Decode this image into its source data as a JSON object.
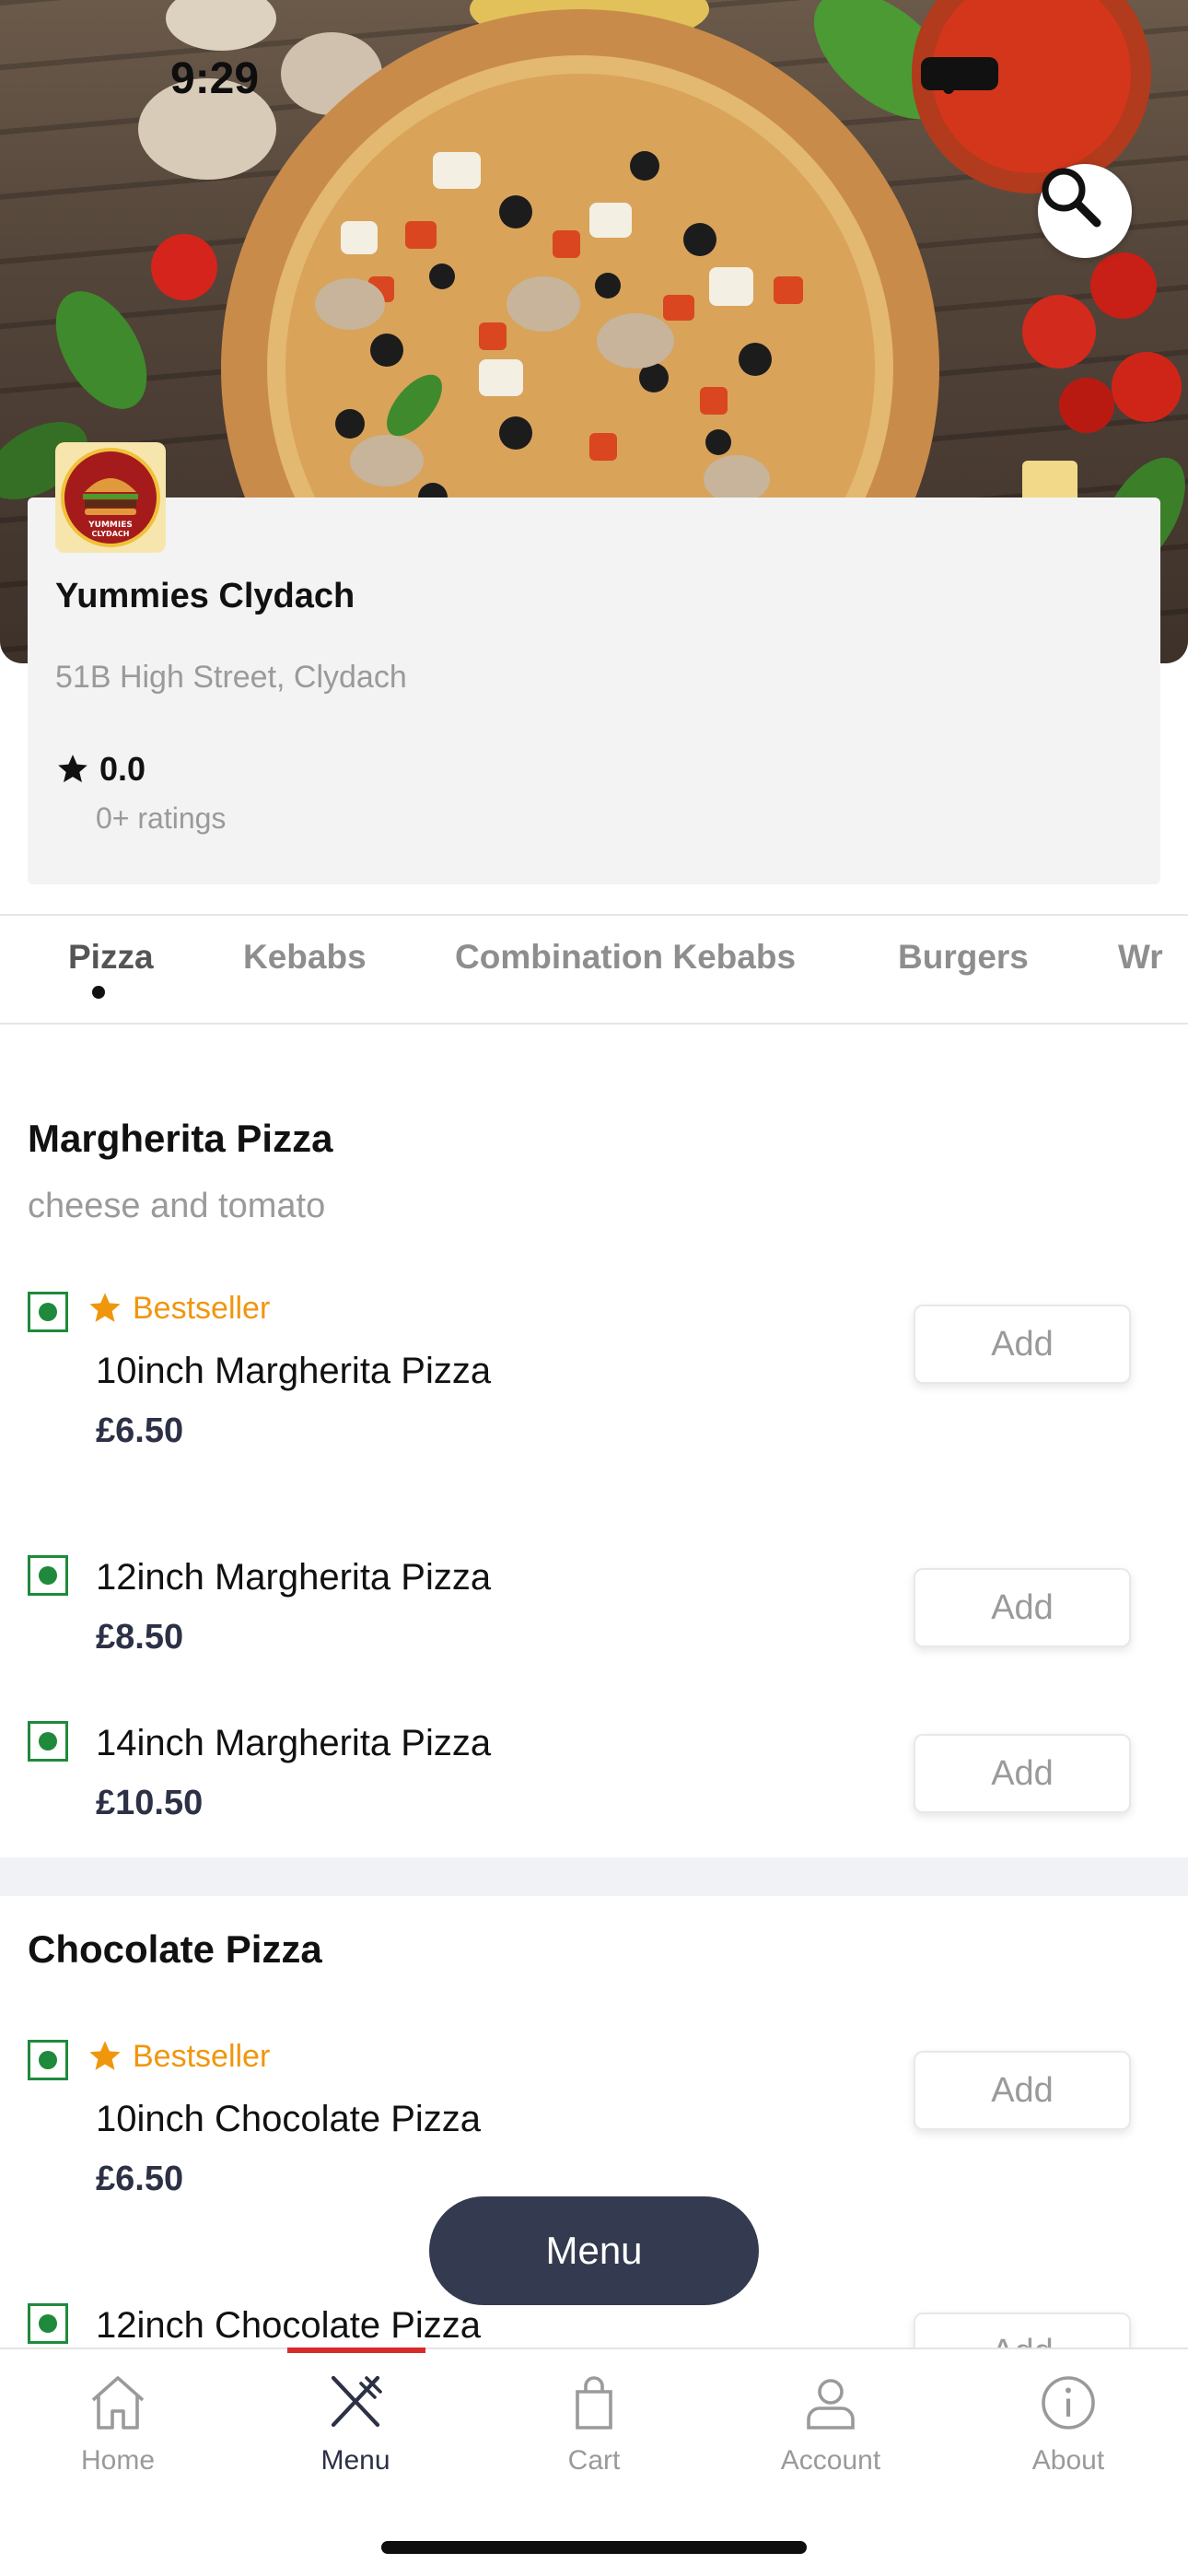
{
  "status_bar": {
    "time": "9:29"
  },
  "header": {
    "search_icon": "search-icon"
  },
  "restaurant": {
    "name": "Yummies Clydach",
    "address": "51B High Street, Clydach",
    "rating": "0.0",
    "ratings_count": "0+ ratings",
    "logo_text": "YUMMIES CLYDACH"
  },
  "categories": [
    {
      "label": "Pizza",
      "active": true
    },
    {
      "label": "Kebabs"
    },
    {
      "label": "Combination Kebabs"
    },
    {
      "label": "Burgers"
    },
    {
      "label": "Wr"
    }
  ],
  "sections": [
    {
      "title": "Margherita Pizza",
      "subtitle": "cheese and tomato",
      "items": [
        {
          "badge": "Bestseller",
          "name": "10inch Margherita Pizza",
          "price": "£6.50",
          "action": "Add"
        },
        {
          "name": "12inch Margherita Pizza",
          "price": "£8.50",
          "action": "Add"
        },
        {
          "name": "14inch Margherita Pizza",
          "price": "£10.50",
          "action": "Add"
        }
      ]
    },
    {
      "title": "Chocolate Pizza",
      "items": [
        {
          "badge": "Bestseller",
          "name": "10inch Chocolate Pizza",
          "price": "£6.50",
          "action": "Add"
        },
        {
          "name": "12inch Chocolate Pizza",
          "action": "Add"
        }
      ]
    }
  ],
  "floating_button": {
    "label": "Menu"
  },
  "bottom_nav": [
    {
      "label": "Home",
      "icon": "home-icon"
    },
    {
      "label": "Menu",
      "icon": "fork-knife-icon",
      "active": true
    },
    {
      "label": "Cart",
      "icon": "bag-icon"
    },
    {
      "label": "Account",
      "icon": "user-icon"
    },
    {
      "label": "About",
      "icon": "info-icon"
    }
  ],
  "colors": {
    "accent_dark": "#343a4f",
    "veg_green": "#1f8a3c",
    "bestseller_orange": "#f0960c",
    "nav_active_bar": "#d92a2a"
  }
}
